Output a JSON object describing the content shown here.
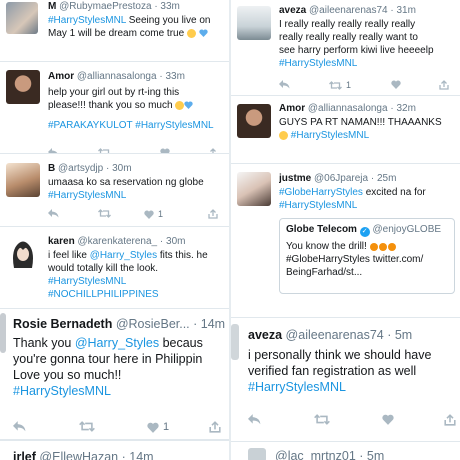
{
  "left": {
    "tweets": [
      {
        "name": "M",
        "handle": "@RubymaePrestoza",
        "time": "· 33m",
        "lines": [
          "#HarryStylesMNL Seeing you live on",
          "May 1 will be dream come true"
        ],
        "emoji": [
          "heart-eyes-emoji",
          "blue-heart-emoji"
        ]
      },
      {
        "name": "Amor",
        "handle": "@alliannasalonga",
        "time": "· 33m",
        "lines": [
          "help your girl out by rt-ing this",
          "please!!! thank you so much",
          "#PARAKAYKULOT #HarryStylesMNL"
        ],
        "emoji": [
          "grin-emoji",
          "blue-heart-emoji"
        ]
      },
      {
        "name": "B",
        "handle": "@artsydjp",
        "time": "· 30m",
        "lines": [
          "umaasa ko sa reservation ng globe",
          "#HarryStylesMNL"
        ],
        "like_count": "1"
      },
      {
        "name": "karen",
        "handle": "@karenkaterena_",
        "time": "· 30m",
        "lines": [
          "i feel like @Harry_Styles fits this. he",
          "would totally kill the look.",
          "#HarryStylesMNL",
          "#NOCHILLPHILIPPINES"
        ]
      },
      {
        "name": "Rosie Bernadeth",
        "handle": "@RosieBer...",
        "time": "· 14m",
        "lines": [
          "Thank you @Harry_Styles becaus",
          "you're gonna tour here in Philippin",
          "Love you so much!!",
          "#HarryStylesMNL"
        ],
        "like_count": "1"
      },
      {
        "name": "irlef",
        "handle": "@EllewHazan",
        "time": "· 14m"
      }
    ]
  },
  "right": {
    "tweets": [
      {
        "name": "aveza",
        "handle": "@aileenarenas74",
        "time": "· 31m",
        "lines": [
          "I really really really really really",
          "really really really really want to",
          "see harry perform kiwi live heeeelp",
          "#HarryStylesMNL"
        ],
        "retweet_count": "1"
      },
      {
        "name": "Amor",
        "handle": "@alliannasalonga",
        "time": "· 32m",
        "lines": [
          "GUYS PA RT NAMAN!!! THAAANKS",
          "#HarryStylesMNL"
        ],
        "emoji": [
          "grin-emoji"
        ]
      },
      {
        "name": "justme",
        "handle": "@06Jpareja",
        "time": "· 25m",
        "lines": [
          "#GlobeHarryStyles excited na for",
          "#HarryStylesMNL"
        ],
        "quote": {
          "name": "Globe Telecom",
          "handle": "@enjoyGLOBE",
          "lines": [
            "You know the drill!",
            "#GlobeHarryStyles twitter.com/",
            "BeingFarhad/st..."
          ]
        }
      },
      {
        "name": "aveza",
        "handle": "@aileenarenas74",
        "time": "· 5m",
        "lines": [
          "i personally think we should have",
          "verified fan registration as well",
          "#HarryStylesMNL"
        ]
      },
      {
        "name": "",
        "handle": "@lac_mrtnz01",
        "time": "· 5m"
      }
    ]
  },
  "colors": {
    "hashtag": "#1b95e0",
    "action_icon": "#aab8c2",
    "meta_text": "#657786",
    "divider": "#e1e8ed"
  },
  "icons": [
    "reply-icon",
    "retweet-icon",
    "like-icon",
    "share-icon"
  ]
}
